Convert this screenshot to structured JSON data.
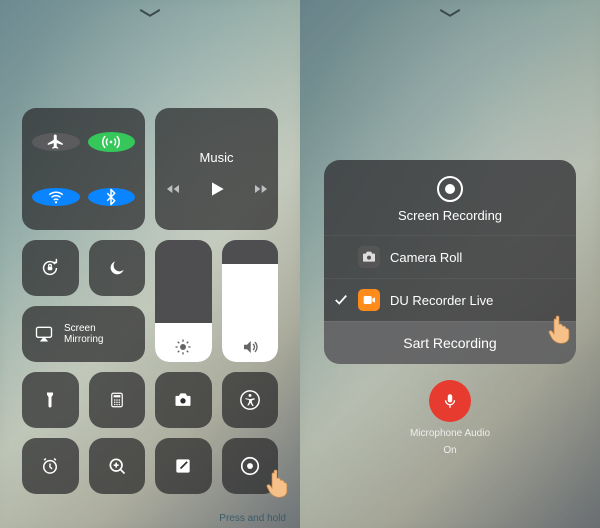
{
  "left": {
    "music_label": "Music",
    "mirror_label": "Screen\nMirroring",
    "hint": "Press and hold"
  },
  "right": {
    "sheet_title": "Screen Recording",
    "options": [
      {
        "label": "Camera Roll"
      },
      {
        "label": "DU Recorder Live"
      }
    ],
    "start_label": "Sart Recording",
    "mic_label_line1": "Microphone Audio",
    "mic_label_line2": "On"
  },
  "colors": {
    "green": "#35c759",
    "blue": "#0a84ff",
    "orange": "#ff8c1a",
    "red": "#e63b2e"
  }
}
